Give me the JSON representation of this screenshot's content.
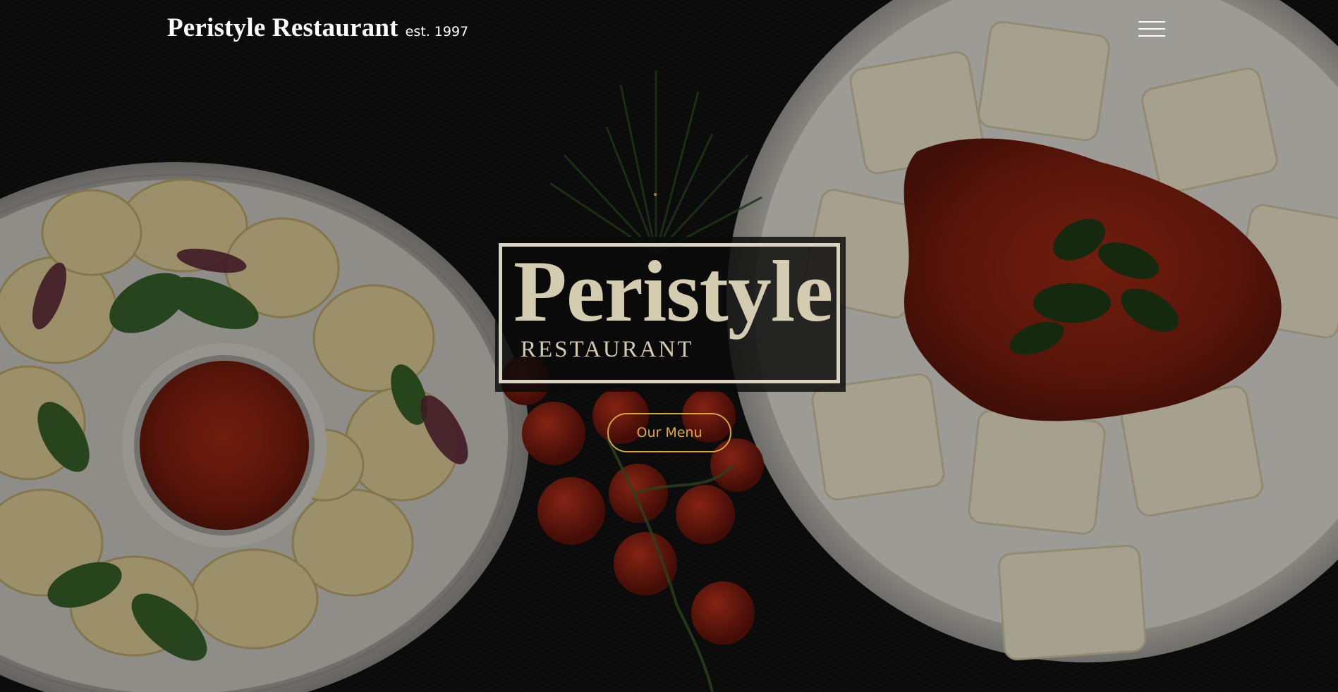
{
  "header": {
    "brand_title": "Peristyle Restaurant",
    "brand_est": "est. 1997"
  },
  "nav": {
    "menu_icon": "hamburger-menu-icon"
  },
  "logo": {
    "word": "Peristyle",
    "sub": "RESTAURANT"
  },
  "cta": {
    "label": "Our Menu"
  },
  "colors": {
    "accent": "#d8a53a",
    "logo_text": "#d4ccb0",
    "header_text": "#ffffff",
    "background": "#0b0b0b"
  }
}
